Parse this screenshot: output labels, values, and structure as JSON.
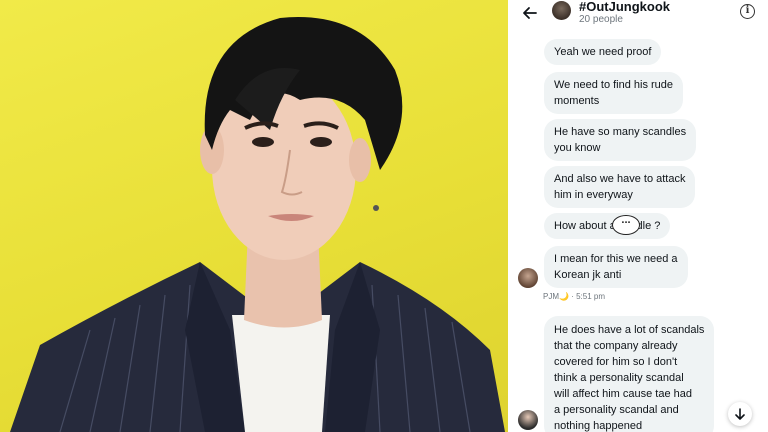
{
  "header": {
    "back_icon": "arrow-left-icon",
    "title": "#OutJungkook",
    "subtitle": "20 people",
    "info_icon": "info-icon",
    "info_glyph": "i"
  },
  "messages": [
    {
      "text": "Yeah we need proof"
    },
    {
      "text": "We need to find his rude\nmoments"
    },
    {
      "text": "He have so many scandles\nyou know"
    },
    {
      "text": "And also we have to attack\nhim in everyway"
    },
    {
      "text": "How about a     candle ?"
    },
    {
      "text": "I mean for this we need a\nKorean jk anti"
    },
    {
      "text": "He does have a lot of scandals\nthat the company already\ncovered for him so I don't\nthink a personality scandal\nwill affect him cause tae had\na personality scandal and\nnothing happened"
    }
  ],
  "typing_indicator": "...",
  "sender_meta": "PJM🌙 · 5:51 pm",
  "scroll_icon": "arrow-down-icon",
  "colors": {
    "photo_bg": "#ede542",
    "bubble_bg": "#eff3f4",
    "text": "#0f1419",
    "muted": "#6e767d"
  }
}
